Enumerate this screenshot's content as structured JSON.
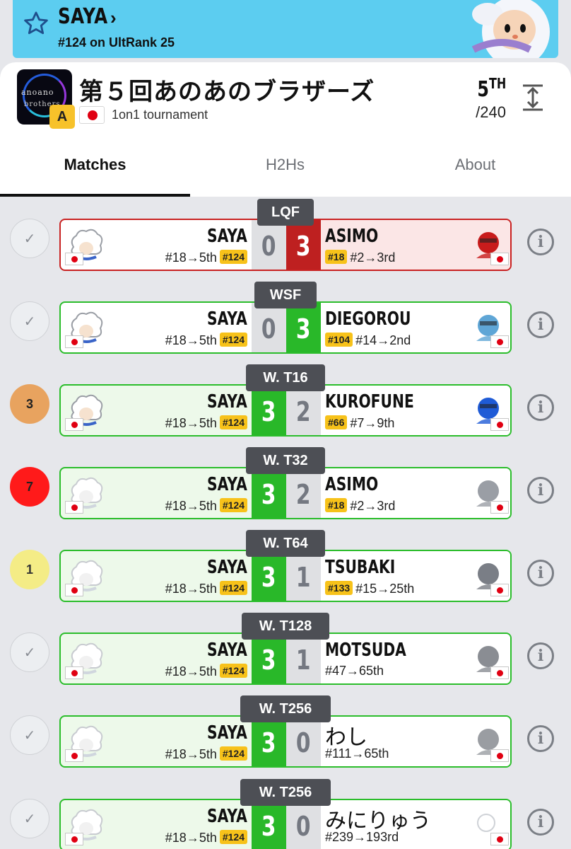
{
  "player": {
    "name": "SAYA",
    "rank_text": "#124 on UltRank 25"
  },
  "tournament": {
    "logo_line1": "anoano",
    "logo_line2": "brothers",
    "tier": "A",
    "title": "第５回あのあのブラザーズ",
    "type": "1on1 tournament",
    "placement": "5",
    "placement_suffix": "TH",
    "entrants": "/240"
  },
  "tabs": [
    {
      "label": "Matches",
      "active": true
    },
    {
      "label": "H2Hs",
      "active": false
    },
    {
      "label": "About",
      "active": false
    }
  ],
  "matches": [
    {
      "round": "LQF",
      "status": "✓",
      "player": "SAYA",
      "player_seed": "#18→5th",
      "player_badge": "#124",
      "player_score": "0",
      "opp_score": "3",
      "opponent": "ASIMO",
      "opp_badge": "#18",
      "opp_seed": "#2→3rd",
      "result": "loss"
    },
    {
      "round": "WSF",
      "status": "✓",
      "player": "SAYA",
      "player_seed": "#18→5th",
      "player_badge": "#124",
      "player_score": "0",
      "opp_score": "3",
      "opponent": "DIEGOROU",
      "opp_badge": "#104",
      "opp_seed": "#14→2nd",
      "result": "loss-green"
    },
    {
      "round": "W. T16",
      "status": "3",
      "player": "SAYA",
      "player_seed": "#18→5th",
      "player_badge": "#124",
      "player_score": "3",
      "opp_score": "2",
      "opponent": "KUROFUNE",
      "opp_badge": "#66",
      "opp_seed": "#7→9th",
      "result": "win"
    },
    {
      "round": "W. T32",
      "status": "7",
      "player": "SAYA",
      "player_seed": "#18→5th",
      "player_badge": "#124",
      "player_score": "3",
      "opp_score": "2",
      "opponent": "ASIMO",
      "opp_badge": "#18",
      "opp_seed": "#2→3rd",
      "result": "win"
    },
    {
      "round": "W. T64",
      "status": "1",
      "player": "SAYA",
      "player_seed": "#18→5th",
      "player_badge": "#124",
      "player_score": "3",
      "opp_score": "1",
      "opponent": "TSUBAKI",
      "opp_badge": "#133",
      "opp_seed": "#15→25th",
      "result": "win"
    },
    {
      "round": "W. T128",
      "status": "✓",
      "player": "SAYA",
      "player_seed": "#18→5th",
      "player_badge": "#124",
      "player_score": "3",
      "opp_score": "1",
      "opponent": "MOTSUDA",
      "opp_badge": "",
      "opp_seed": "#47→65th",
      "result": "win"
    },
    {
      "round": "W. T256",
      "status": "✓",
      "player": "SAYA",
      "player_seed": "#18→5th",
      "player_badge": "#124",
      "player_score": "3",
      "opp_score": "0",
      "opponent": "わし",
      "opp_badge": "",
      "opp_seed": "#111→65th",
      "result": "win"
    },
    {
      "round": "W. T256",
      "status": "✓",
      "player": "SAYA",
      "player_seed": "#18→5th",
      "player_badge": "#124",
      "player_score": "3",
      "opp_score": "0",
      "opponent": "みにりゅう",
      "opp_badge": "",
      "opp_seed": "#239→193rd",
      "result": "win"
    }
  ],
  "colors": {
    "banner": "#5ccdf0",
    "win_border": "#2bbd2b",
    "loss_border": "#c92222",
    "badge": "#f7c21a",
    "status_3": "#e8a35f",
    "status_7": "#ff1a1a",
    "status_1": "#f4ec86"
  },
  "icons": {
    "favorite": "star-outline-icon",
    "expand": "expand-vertical-icon",
    "info": "info-circle-icon",
    "done": "check-icon"
  }
}
